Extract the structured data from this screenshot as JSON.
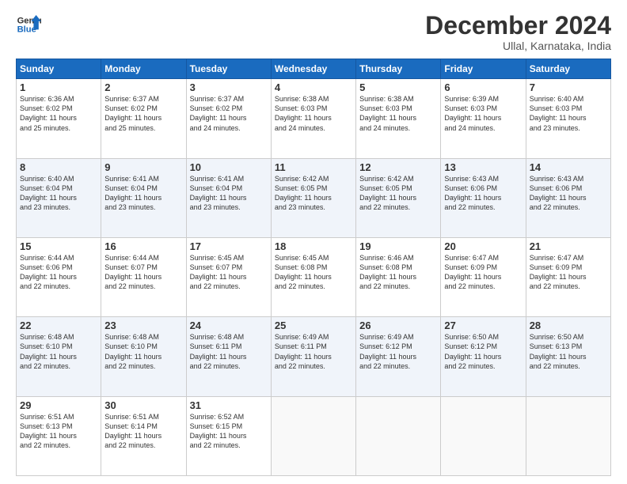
{
  "logo": {
    "line1": "General",
    "line2": "Blue"
  },
  "title": "December 2024",
  "location": "Ullal, Karnataka, India",
  "days_header": [
    "Sunday",
    "Monday",
    "Tuesday",
    "Wednesday",
    "Thursday",
    "Friday",
    "Saturday"
  ],
  "weeks": [
    [
      {
        "day": "1",
        "info": "Sunrise: 6:36 AM\nSunset: 6:02 PM\nDaylight: 11 hours\nand 25 minutes."
      },
      {
        "day": "2",
        "info": "Sunrise: 6:37 AM\nSunset: 6:02 PM\nDaylight: 11 hours\nand 25 minutes."
      },
      {
        "day": "3",
        "info": "Sunrise: 6:37 AM\nSunset: 6:02 PM\nDaylight: 11 hours\nand 24 minutes."
      },
      {
        "day": "4",
        "info": "Sunrise: 6:38 AM\nSunset: 6:03 PM\nDaylight: 11 hours\nand 24 minutes."
      },
      {
        "day": "5",
        "info": "Sunrise: 6:38 AM\nSunset: 6:03 PM\nDaylight: 11 hours\nand 24 minutes."
      },
      {
        "day": "6",
        "info": "Sunrise: 6:39 AM\nSunset: 6:03 PM\nDaylight: 11 hours\nand 24 minutes."
      },
      {
        "day": "7",
        "info": "Sunrise: 6:40 AM\nSunset: 6:03 PM\nDaylight: 11 hours\nand 23 minutes."
      }
    ],
    [
      {
        "day": "8",
        "info": "Sunrise: 6:40 AM\nSunset: 6:04 PM\nDaylight: 11 hours\nand 23 minutes."
      },
      {
        "day": "9",
        "info": "Sunrise: 6:41 AM\nSunset: 6:04 PM\nDaylight: 11 hours\nand 23 minutes."
      },
      {
        "day": "10",
        "info": "Sunrise: 6:41 AM\nSunset: 6:04 PM\nDaylight: 11 hours\nand 23 minutes."
      },
      {
        "day": "11",
        "info": "Sunrise: 6:42 AM\nSunset: 6:05 PM\nDaylight: 11 hours\nand 23 minutes."
      },
      {
        "day": "12",
        "info": "Sunrise: 6:42 AM\nSunset: 6:05 PM\nDaylight: 11 hours\nand 22 minutes."
      },
      {
        "day": "13",
        "info": "Sunrise: 6:43 AM\nSunset: 6:06 PM\nDaylight: 11 hours\nand 22 minutes."
      },
      {
        "day": "14",
        "info": "Sunrise: 6:43 AM\nSunset: 6:06 PM\nDaylight: 11 hours\nand 22 minutes."
      }
    ],
    [
      {
        "day": "15",
        "info": "Sunrise: 6:44 AM\nSunset: 6:06 PM\nDaylight: 11 hours\nand 22 minutes."
      },
      {
        "day": "16",
        "info": "Sunrise: 6:44 AM\nSunset: 6:07 PM\nDaylight: 11 hours\nand 22 minutes."
      },
      {
        "day": "17",
        "info": "Sunrise: 6:45 AM\nSunset: 6:07 PM\nDaylight: 11 hours\nand 22 minutes."
      },
      {
        "day": "18",
        "info": "Sunrise: 6:45 AM\nSunset: 6:08 PM\nDaylight: 11 hours\nand 22 minutes."
      },
      {
        "day": "19",
        "info": "Sunrise: 6:46 AM\nSunset: 6:08 PM\nDaylight: 11 hours\nand 22 minutes."
      },
      {
        "day": "20",
        "info": "Sunrise: 6:47 AM\nSunset: 6:09 PM\nDaylight: 11 hours\nand 22 minutes."
      },
      {
        "day": "21",
        "info": "Sunrise: 6:47 AM\nSunset: 6:09 PM\nDaylight: 11 hours\nand 22 minutes."
      }
    ],
    [
      {
        "day": "22",
        "info": "Sunrise: 6:48 AM\nSunset: 6:10 PM\nDaylight: 11 hours\nand 22 minutes."
      },
      {
        "day": "23",
        "info": "Sunrise: 6:48 AM\nSunset: 6:10 PM\nDaylight: 11 hours\nand 22 minutes."
      },
      {
        "day": "24",
        "info": "Sunrise: 6:48 AM\nSunset: 6:11 PM\nDaylight: 11 hours\nand 22 minutes."
      },
      {
        "day": "25",
        "info": "Sunrise: 6:49 AM\nSunset: 6:11 PM\nDaylight: 11 hours\nand 22 minutes."
      },
      {
        "day": "26",
        "info": "Sunrise: 6:49 AM\nSunset: 6:12 PM\nDaylight: 11 hours\nand 22 minutes."
      },
      {
        "day": "27",
        "info": "Sunrise: 6:50 AM\nSunset: 6:12 PM\nDaylight: 11 hours\nand 22 minutes."
      },
      {
        "day": "28",
        "info": "Sunrise: 6:50 AM\nSunset: 6:13 PM\nDaylight: 11 hours\nand 22 minutes."
      }
    ],
    [
      {
        "day": "29",
        "info": "Sunrise: 6:51 AM\nSunset: 6:13 PM\nDaylight: 11 hours\nand 22 minutes."
      },
      {
        "day": "30",
        "info": "Sunrise: 6:51 AM\nSunset: 6:14 PM\nDaylight: 11 hours\nand 22 minutes."
      },
      {
        "day": "31",
        "info": "Sunrise: 6:52 AM\nSunset: 6:15 PM\nDaylight: 11 hours\nand 22 minutes."
      },
      {
        "day": "",
        "info": ""
      },
      {
        "day": "",
        "info": ""
      },
      {
        "day": "",
        "info": ""
      },
      {
        "day": "",
        "info": ""
      }
    ]
  ]
}
